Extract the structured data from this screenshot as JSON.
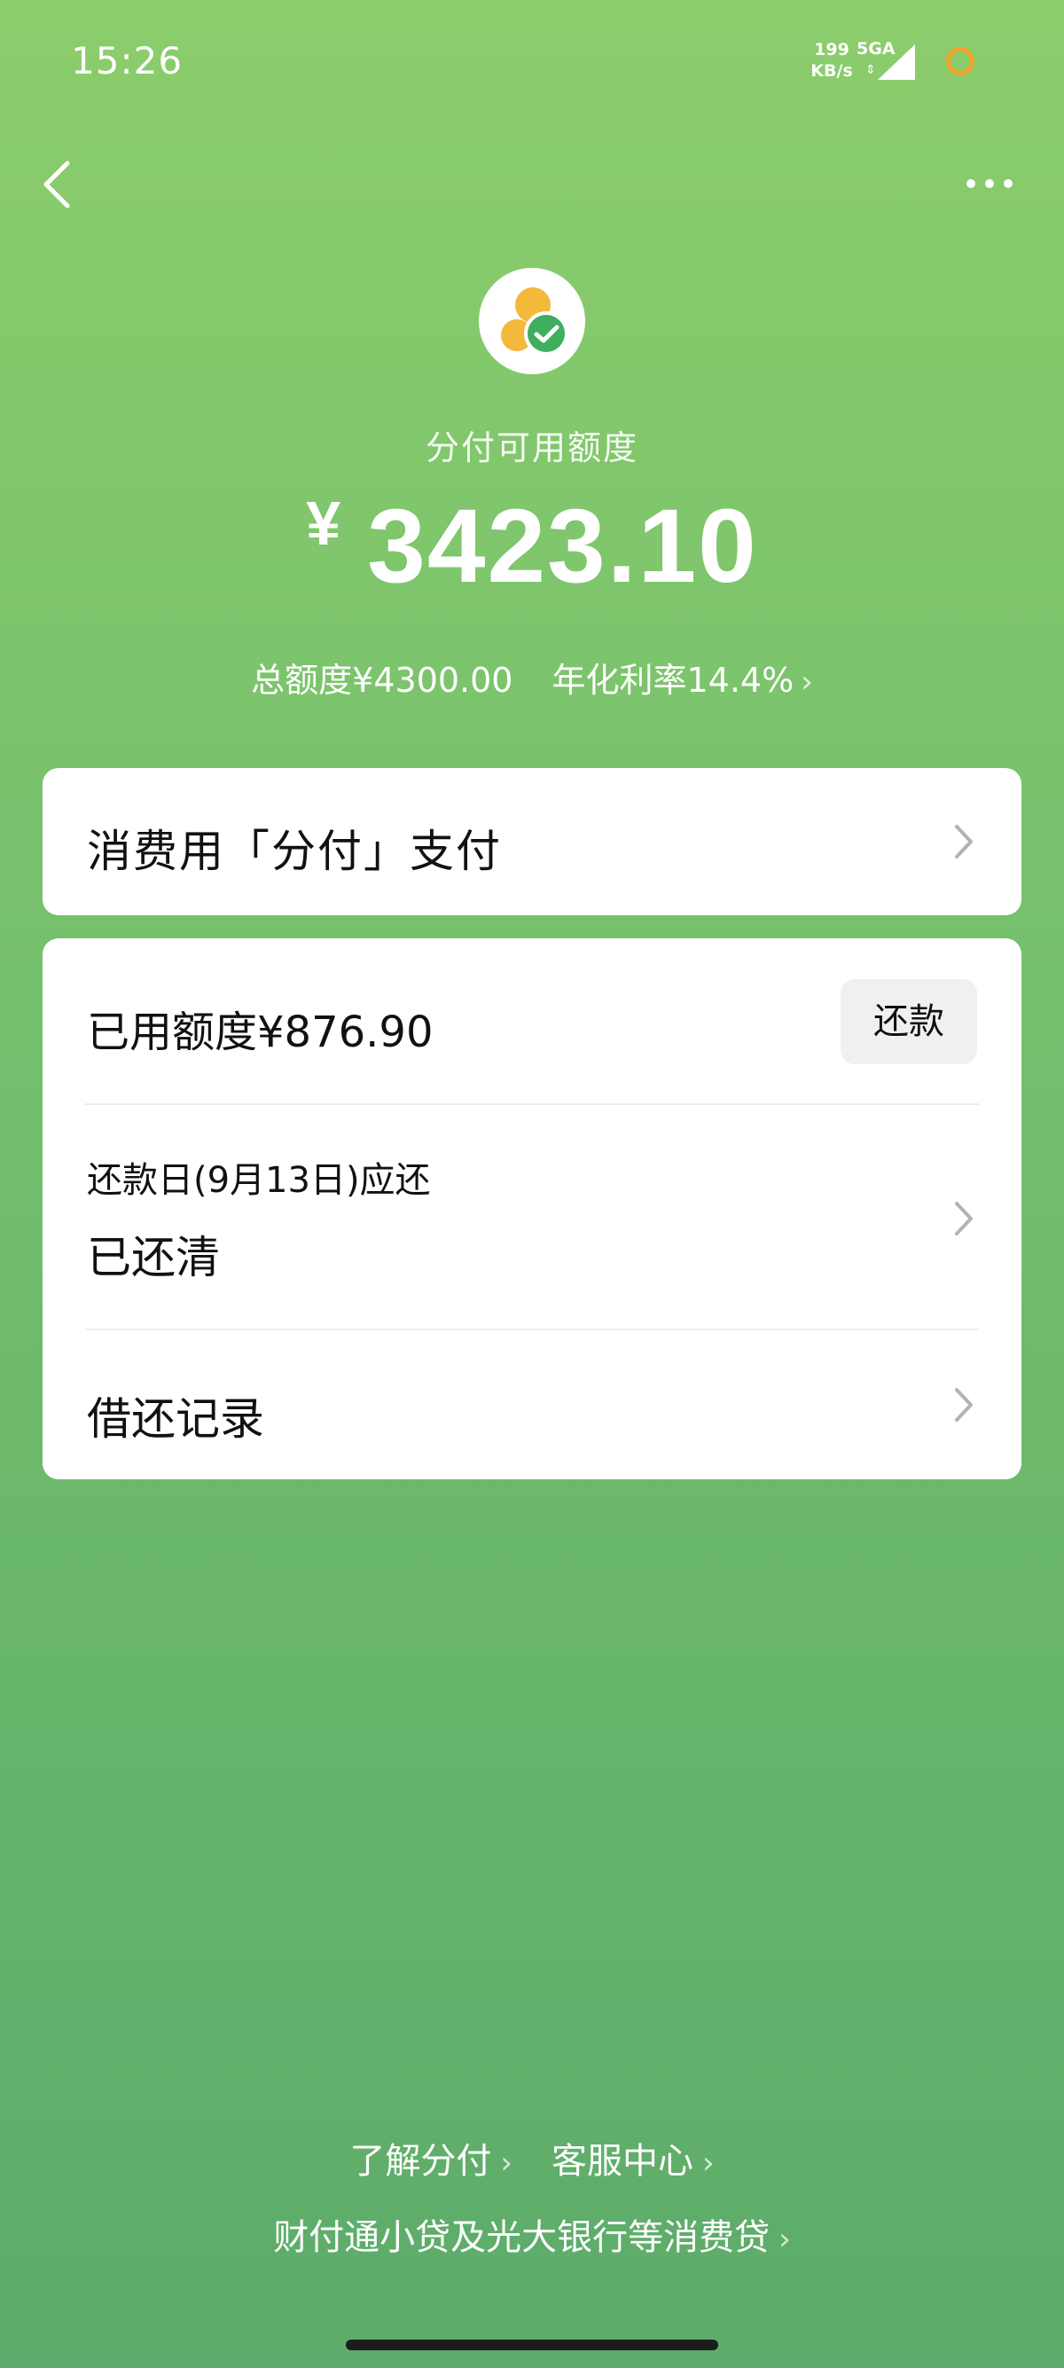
{
  "status_bar": {
    "time": "15:26",
    "net_speed_value": "199",
    "net_speed_unit": "KB/s",
    "network_type": "5GA",
    "network_arrows": "⇕"
  },
  "icons": {
    "back": "chevron-left-icon",
    "more": "more-icon",
    "logo": "fenfu-logo-icon",
    "chevron": "chevron-right-icon"
  },
  "header": {
    "title": "分付可用额度",
    "currency": "¥",
    "amount": "3423.10",
    "total_limit": "总额度¥4300.00",
    "interest_rate": "年化利率14.4%",
    "chevron": "›"
  },
  "pay_card": {
    "label": "消费用「分付」支付"
  },
  "main_card": {
    "used_label": "已用额度¥876.90",
    "repay_button": "还款",
    "due_label": "还款日(9月13日)应还",
    "cleared_label": "已还清",
    "records_label": "借还记录"
  },
  "footer": {
    "about": "了解分付",
    "service": "客服中心",
    "loan": "财付通小贷及光大银行等消费贷",
    "chevron": "›"
  },
  "colors": {
    "bg_top": "#8ccd6c",
    "bg_bottom": "#5cab6a",
    "logo_yellow": "#f2b93b",
    "logo_green": "#3fae5e",
    "battery": "#f0a52a"
  }
}
